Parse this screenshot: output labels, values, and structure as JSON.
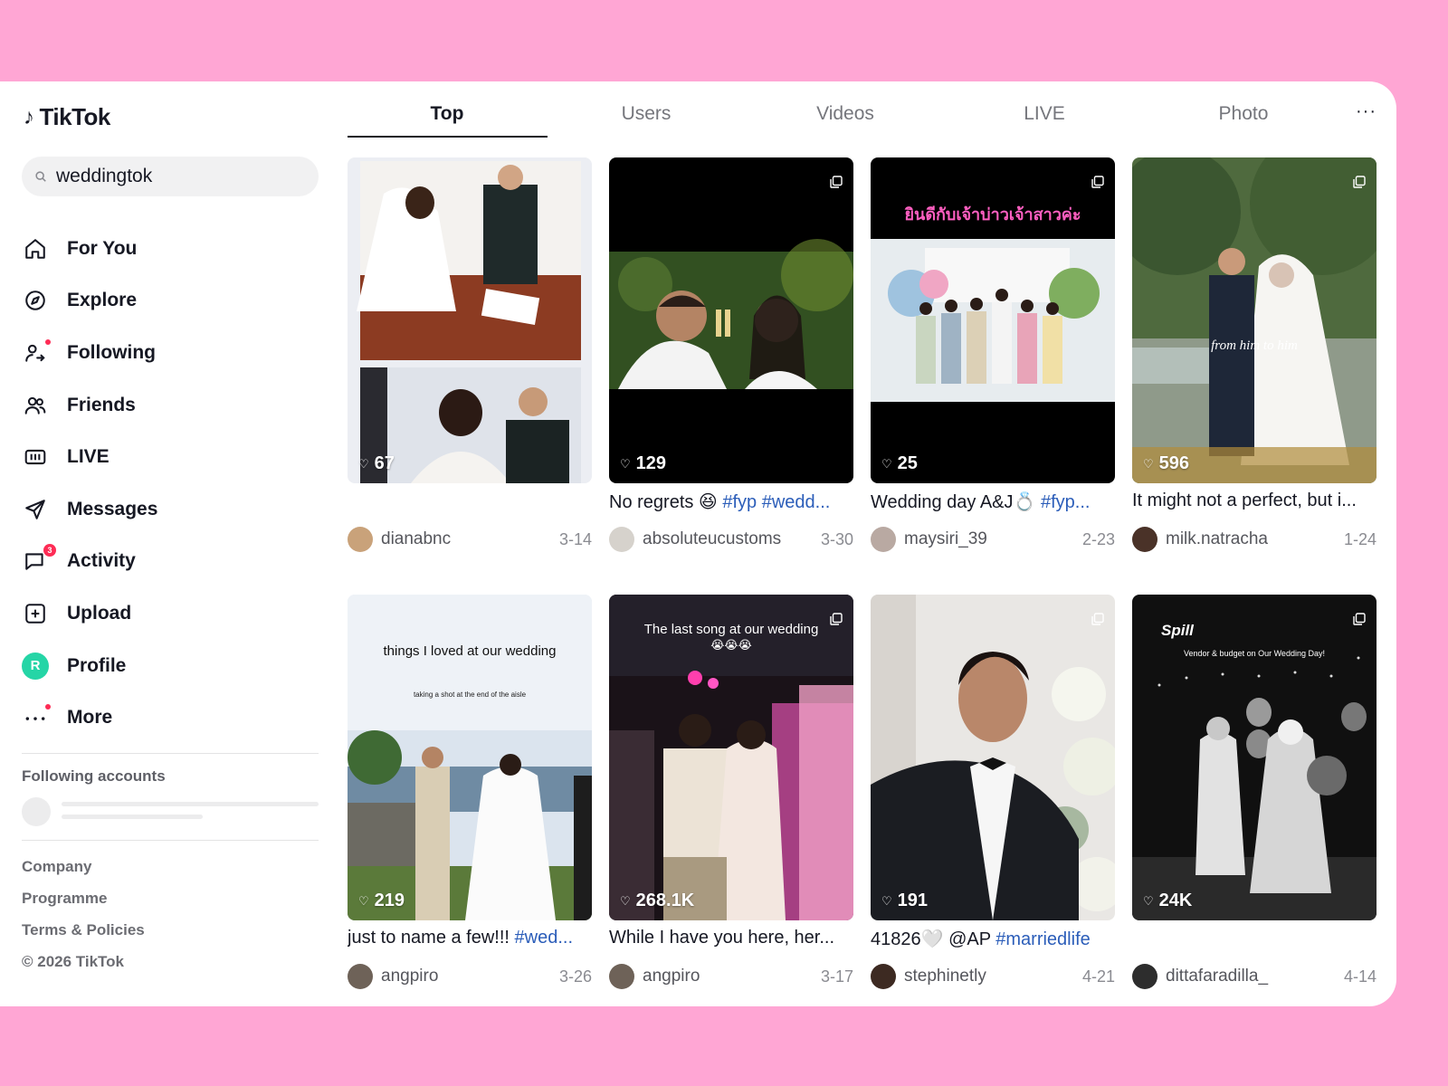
{
  "app": {
    "logo_text": "TikTok"
  },
  "search": {
    "value": "weddingtok"
  },
  "nav": [
    {
      "label": "For You",
      "icon": "home-icon"
    },
    {
      "label": "Explore",
      "icon": "compass-icon"
    },
    {
      "label": "Following",
      "icon": "following-icon"
    },
    {
      "label": "Friends",
      "icon": "friends-icon"
    },
    {
      "label": "LIVE",
      "icon": "live-icon"
    },
    {
      "label": "Messages",
      "icon": "send-icon"
    },
    {
      "label": "Activity",
      "icon": "chat-icon",
      "badge": "3"
    },
    {
      "label": "Upload",
      "icon": "plus-square-icon"
    },
    {
      "label": "Profile",
      "icon": "avatar",
      "avatar_letter": "R"
    },
    {
      "label": "More",
      "icon": "more-icon"
    }
  ],
  "following": {
    "title": "Following accounts"
  },
  "footer": {
    "links": [
      "Company",
      "Programme",
      "Terms & Policies",
      "© 2026 TikTok"
    ]
  },
  "tabs": [
    "Top",
    "Users",
    "Videos",
    "LIVE",
    "Photo"
  ],
  "tabs_more": "···",
  "colors": {
    "accent": "#fe2c55",
    "hashtag": "#2b5db9",
    "background": "#ffa6d4"
  },
  "videos": [
    {
      "likes": "67",
      "caption": "",
      "tags": "",
      "user": "dianabnc",
      "date": "3-14"
    },
    {
      "likes": "129",
      "caption": "No regrets 😆 ",
      "tags": "#fyp #wedd...",
      "user": "absoluteucustoms",
      "date": "3-30"
    },
    {
      "likes": "25",
      "caption": "Wedding day A&J💍 ",
      "tags": "#fyp...",
      "user": "maysiri_39",
      "date": "2-23",
      "overlay": "ยินดีกับเจ้าบ่าวเจ้าสาวค่ะ"
    },
    {
      "likes": "596",
      "caption": "It might not a perfect, but i...",
      "tags": "",
      "user": "milk.natracha",
      "date": "1-24",
      "overlay": "from him to him"
    },
    {
      "likes": "219",
      "caption": "just to name a few!!! ",
      "tags": "#wed...",
      "user": "angpiro",
      "date": "3-26",
      "overlay": "things I loved at our wedding",
      "overlay_sub": "taking a shot at the end of the aisle"
    },
    {
      "likes": "268.1K",
      "caption": "While I have you here, her...",
      "tags": "",
      "user": "angpiro",
      "date": "3-17",
      "overlay": "The last song at our wedding",
      "overlay_sub": "😭😭😭"
    },
    {
      "likes": "191",
      "caption": "41826🤍 @AP ",
      "tags": "#marriedlife",
      "user": "stephinetly",
      "date": "4-21"
    },
    {
      "likes": "24K",
      "caption": "",
      "tags": "",
      "user": "dittafaradilla_",
      "date": "4-14",
      "overlay": "Spill",
      "overlay_sub": "Vendor & budget on Our Wedding Day!"
    }
  ]
}
